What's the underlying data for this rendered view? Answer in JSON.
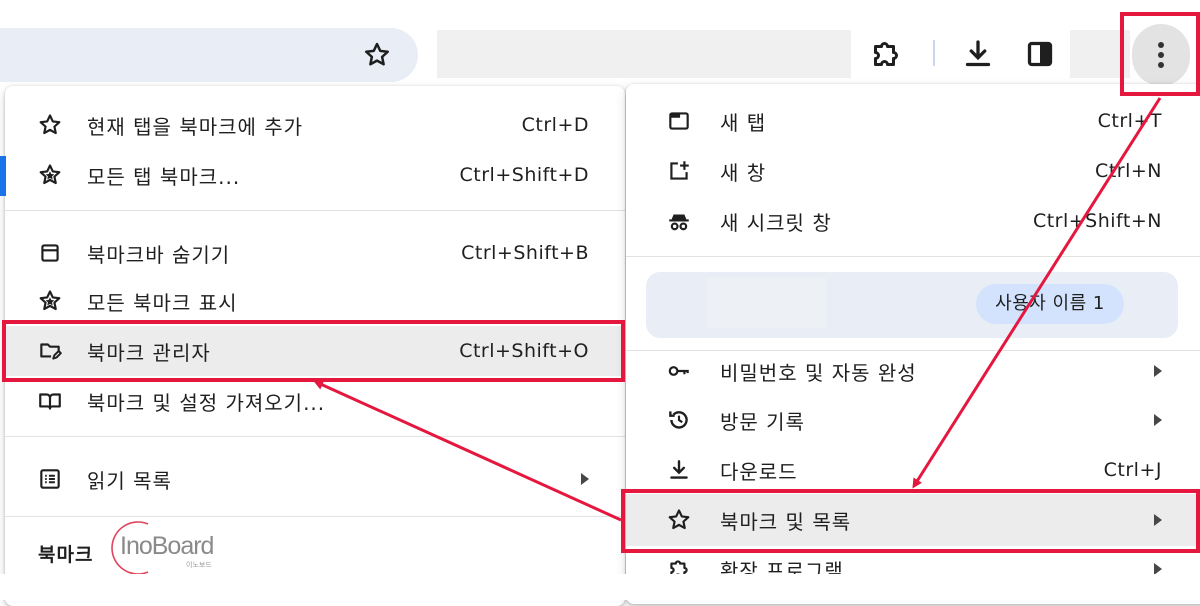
{
  "toolbar": {
    "bookmark_star_icon": "star-outline-icon",
    "extensions_icon": "puzzle-icon",
    "downloads_icon": "download-icon",
    "side_panel_icon": "side-panel-icon",
    "menu_icon": "kebab-menu-icon"
  },
  "bookmarks_submenu": {
    "items": [
      {
        "icon": "star-icon",
        "label": "현재 탭을 북마크에 추가",
        "shortcut": "Ctrl+D"
      },
      {
        "icon": "star-multiple-icon",
        "label": "모든 탭 북마크...",
        "shortcut": "Ctrl+Shift+D"
      },
      {
        "icon": "bookmark-bar-icon",
        "label": "북마크바 숨기기",
        "shortcut": "Ctrl+Shift+B"
      },
      {
        "icon": "star-multiple-icon",
        "label": "모든 북마크 표시",
        "shortcut": ""
      },
      {
        "icon": "folder-edit-icon",
        "label": "북마크 관리자",
        "shortcut": "Ctrl+Shift+O"
      },
      {
        "icon": "book-open-icon",
        "label": "북마크 및 설정 가져오기...",
        "shortcut": ""
      },
      {
        "icon": "reading-list-icon",
        "label": "읽기 목록",
        "shortcut": ""
      }
    ],
    "footer_label": "북마크"
  },
  "main_menu": {
    "items": [
      {
        "icon": "new-tab-icon",
        "label": "새 탭",
        "shortcut": "Ctrl+T"
      },
      {
        "icon": "new-window-icon",
        "label": "새 창",
        "shortcut": "Ctrl+N"
      },
      {
        "icon": "incognito-icon",
        "label": "새 시크릿 창",
        "shortcut": "Ctrl+Shift+N"
      },
      {
        "icon": "key-icon",
        "label": "비밀번호 및 자동 완성",
        "shortcut": ""
      },
      {
        "icon": "history-icon",
        "label": "방문 기록",
        "shortcut": ""
      },
      {
        "icon": "download-icon",
        "label": "다운로드",
        "shortcut": "Ctrl+J"
      },
      {
        "icon": "star-icon",
        "label": "북마크 및 목록",
        "shortcut": ""
      },
      {
        "icon": "puzzle-icon",
        "label": "확장 프로그램",
        "shortcut": ""
      }
    ],
    "profile": {
      "name": "사용자 이름 1"
    }
  },
  "watermark": {
    "text": "InoBoard",
    "sub": "이노보드"
  },
  "colors": {
    "annotation_red": "#e5173f",
    "hover_gray": "#ececec",
    "profile_bg": "#e9eef6",
    "pill_bg": "#d3e3fd"
  }
}
